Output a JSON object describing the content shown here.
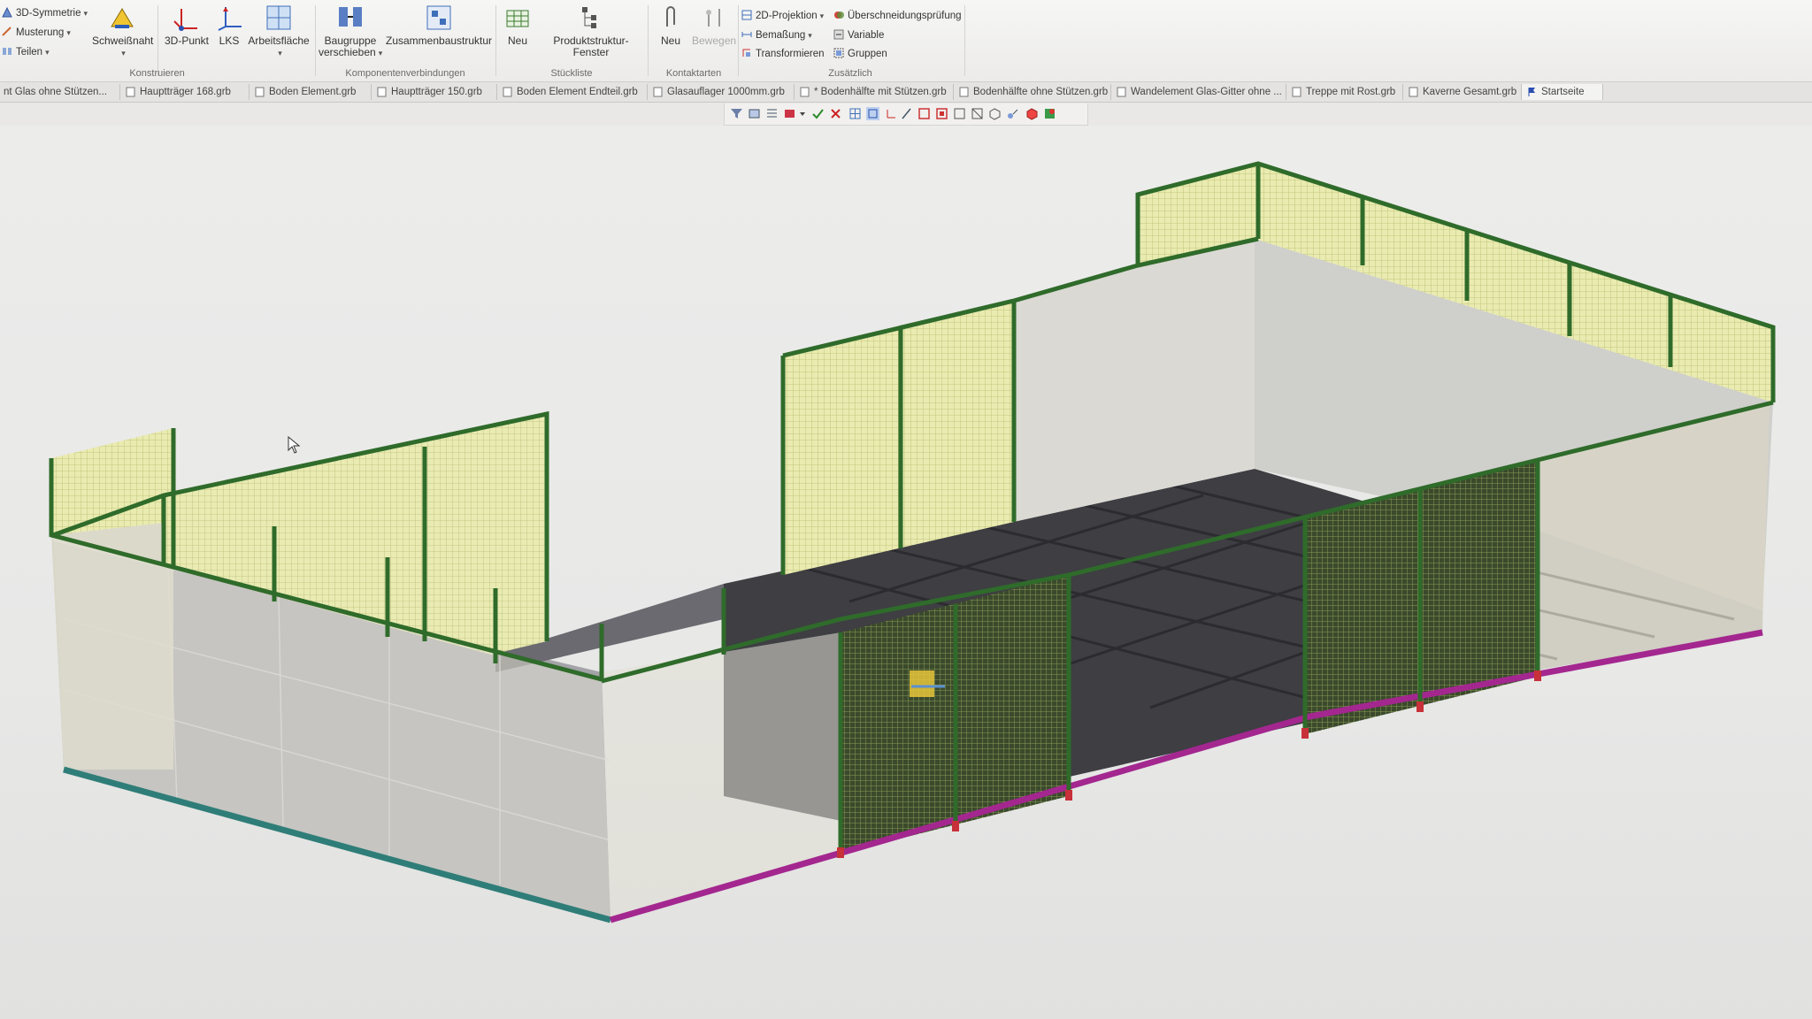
{
  "ribbon": {
    "symmetry": {
      "label": "3D-Symmetrie"
    },
    "pattern": {
      "label": "Musterung"
    },
    "split": {
      "label": "Teilen"
    },
    "weld": {
      "label": "Schweißnaht"
    },
    "point3d": {
      "label": "3D-Punkt"
    },
    "lks": {
      "label": "LKS"
    },
    "workplane": {
      "label": "Arbeitsfläche"
    },
    "konstruieren_caption": "Konstruieren",
    "move_group": {
      "line1": "Baugruppe",
      "line2": "verschieben"
    },
    "restructure": {
      "label": "Zusammenbaustruktur"
    },
    "komponenten_caption": "Komponentenverbindungen",
    "bom_new": {
      "label": "Neu"
    },
    "product_window": {
      "label": "Produktstruktur-Fenster"
    },
    "stueckliste_caption": "Stückliste",
    "contact_new": {
      "label": "Neu"
    },
    "contact_move": {
      "label": "Bewegen"
    },
    "kontaktarten_caption": "Kontaktarten",
    "projection": {
      "label": "2D-Projektion"
    },
    "dimension": {
      "label": "Bemaßung"
    },
    "transform": {
      "label": "Transformieren"
    },
    "intersection": {
      "label": "Überschneidungsprüfung"
    },
    "variable": {
      "label": "Variable"
    },
    "groups": {
      "label": "Gruppen"
    },
    "zusaetzlich_caption": "Zusätzlich"
  },
  "tabs": [
    {
      "label": "nt Glas ohne Stützen..."
    },
    {
      "label": "Hauptträger 168.grb"
    },
    {
      "label": "Boden Element.grb"
    },
    {
      "label": "Hauptträger 150.grb"
    },
    {
      "label": "Boden Element Endteil.grb"
    },
    {
      "label": "Glasauflager 1000mm.grb"
    },
    {
      "label": "* Bodenhälfte mit Stützen.grb"
    },
    {
      "label": "Bodenhälfte ohne Stützen.grb"
    },
    {
      "label": "Wandelement Glas-Gitter ohne ..."
    },
    {
      "label": "Treppe mit Rost.grb"
    },
    {
      "label": "Kaverne Gesamt.grb"
    },
    {
      "label": "Startseite"
    }
  ],
  "colors": {
    "frame_green": "#2f6b2a",
    "mesh_yellow": "#e4e6a2",
    "floor_dark": "#3f3f44",
    "floor_light": "#9b9b9f",
    "beam_magenta": "#a3278f",
    "beam_teal": "#2f7d78"
  },
  "icons": {
    "weld": "weld-seam-icon",
    "point3d": "axis-point-icon",
    "workplane": "grid-plane-icon",
    "move": "assembly-move-icon",
    "restructure": "structure-tree-icon"
  }
}
